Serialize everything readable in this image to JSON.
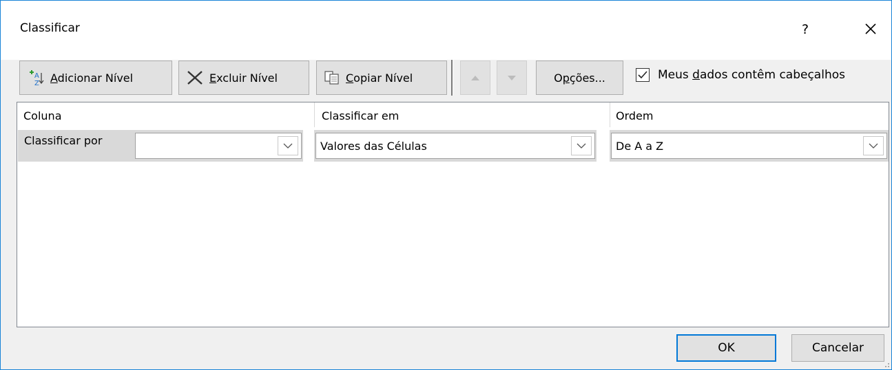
{
  "dialog": {
    "title": "Classificar",
    "help_label": "?"
  },
  "toolbar": {
    "add_level": {
      "underline": "A",
      "rest": "dicionar Nível",
      "icon": "add-sort-level-icon"
    },
    "delete_level": {
      "underline": "E",
      "rest": "xcluir Nível",
      "icon": "delete-x-icon"
    },
    "copy_level": {
      "underline": "C",
      "rest": "opiar Nível",
      "icon": "copy-icon"
    },
    "move_up_icon": "move-up-icon",
    "move_down_icon": "move-down-icon",
    "options": {
      "prefix": "O",
      "underline": "p",
      "rest": "ções..."
    },
    "headers_checkbox": {
      "prefix": "Meus ",
      "underline": "d",
      "rest": "ados contêm cabeçalhos",
      "checked": true
    }
  },
  "grid": {
    "headers": {
      "column": "Coluna",
      "sort_on": "Classificar em",
      "order": "Ordem"
    },
    "rows": [
      {
        "label": "Classificar por",
        "column_value": "",
        "sort_on_value": "Valores das Células",
        "order_value": "De A a Z"
      }
    ]
  },
  "buttons": {
    "ok": "OK",
    "cancel": "Cancelar"
  },
  "colors": {
    "accent": "#0078d7",
    "border": "#1883d7",
    "row_label_bg": "#d9d9d9"
  }
}
